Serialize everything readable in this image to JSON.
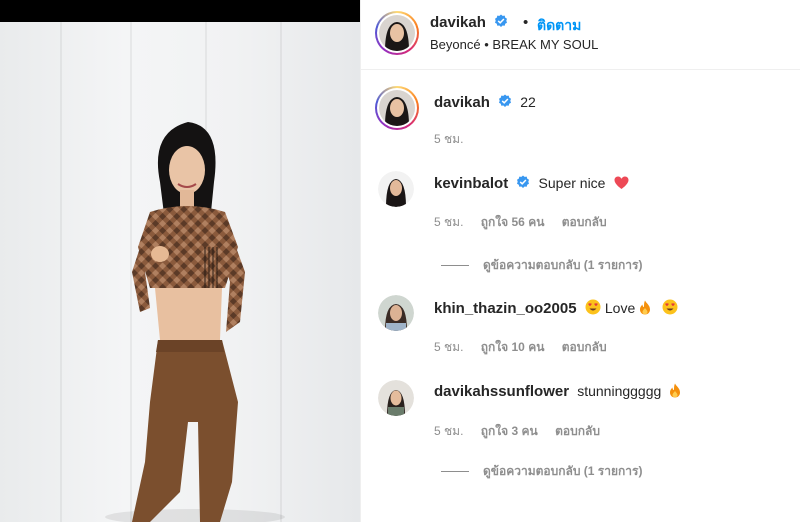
{
  "post": {
    "author": "davikah",
    "follow_label": "ติดตาม",
    "separator": "•",
    "audio": "Beyoncé • BREAK MY SOUL"
  },
  "caption": {
    "username": "davikah",
    "text": "22",
    "time": "5 ชม."
  },
  "comments": [
    {
      "username": "kevinbalot",
      "text": "Super nice",
      "time": "5 ชม.",
      "likes": "ถูกใจ 56 คน",
      "reply": "ตอบกลับ",
      "view_replies": "ดูข้อความตอบกลับ (1 รายการ)"
    },
    {
      "username": "khin_thazin_oo2005",
      "text": "Love",
      "time": "5 ชม.",
      "likes": "ถูกใจ 10 คน",
      "reply": "ตอบกลับ"
    },
    {
      "username": "davikahssunflower",
      "text": "stunninggggg",
      "time": "5 ชม.",
      "likes": "ถูกใจ 3 คน",
      "reply": "ตอบกลับ",
      "view_replies": "ดูข้อความตอบกลับ (1 รายการ)"
    }
  ],
  "colors": {
    "link_blue": "#0095f6",
    "verified_blue": "#3897f0",
    "muted_text": "#8e8e8e",
    "heart_red": "#ed4956"
  },
  "icons": [
    "verified-badge-icon",
    "red-heart-icon",
    "heart-eyes-emoji-icon",
    "fire-emoji-icon"
  ]
}
